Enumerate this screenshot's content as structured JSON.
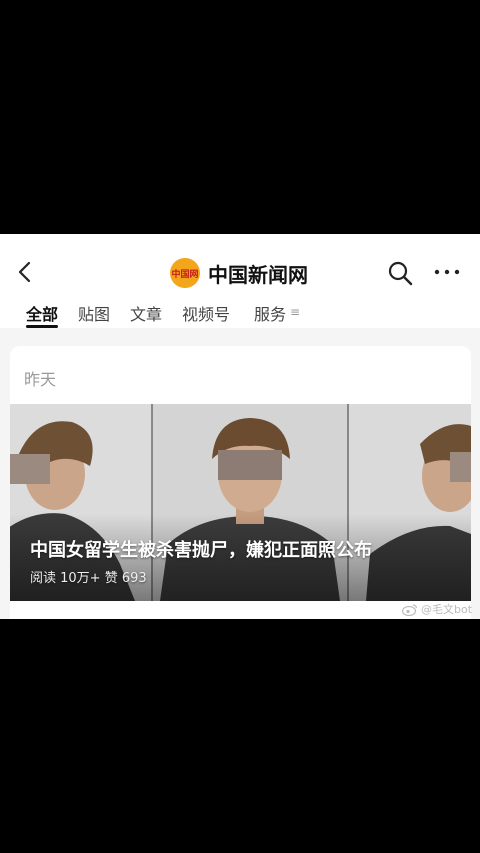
{
  "header": {
    "title": "中国新闻网",
    "logo_text": "中国网"
  },
  "tabs": [
    {
      "label": "全部",
      "active": true
    },
    {
      "label": "贴图",
      "active": false
    },
    {
      "label": "文章",
      "active": false
    },
    {
      "label": "视频号",
      "active": false
    },
    {
      "label": "服务",
      "active": false
    }
  ],
  "tabs_overflow": "≡",
  "card": {
    "date": "昨天",
    "headline": "中国女留学生被杀害抛尸，嫌犯正面照公布",
    "stats": "阅读 10万+  赞 693"
  },
  "watermark": "@毛文bot",
  "icons": [
    "back-arrow-icon",
    "search-icon",
    "more-icon",
    "weibo-icon"
  ]
}
